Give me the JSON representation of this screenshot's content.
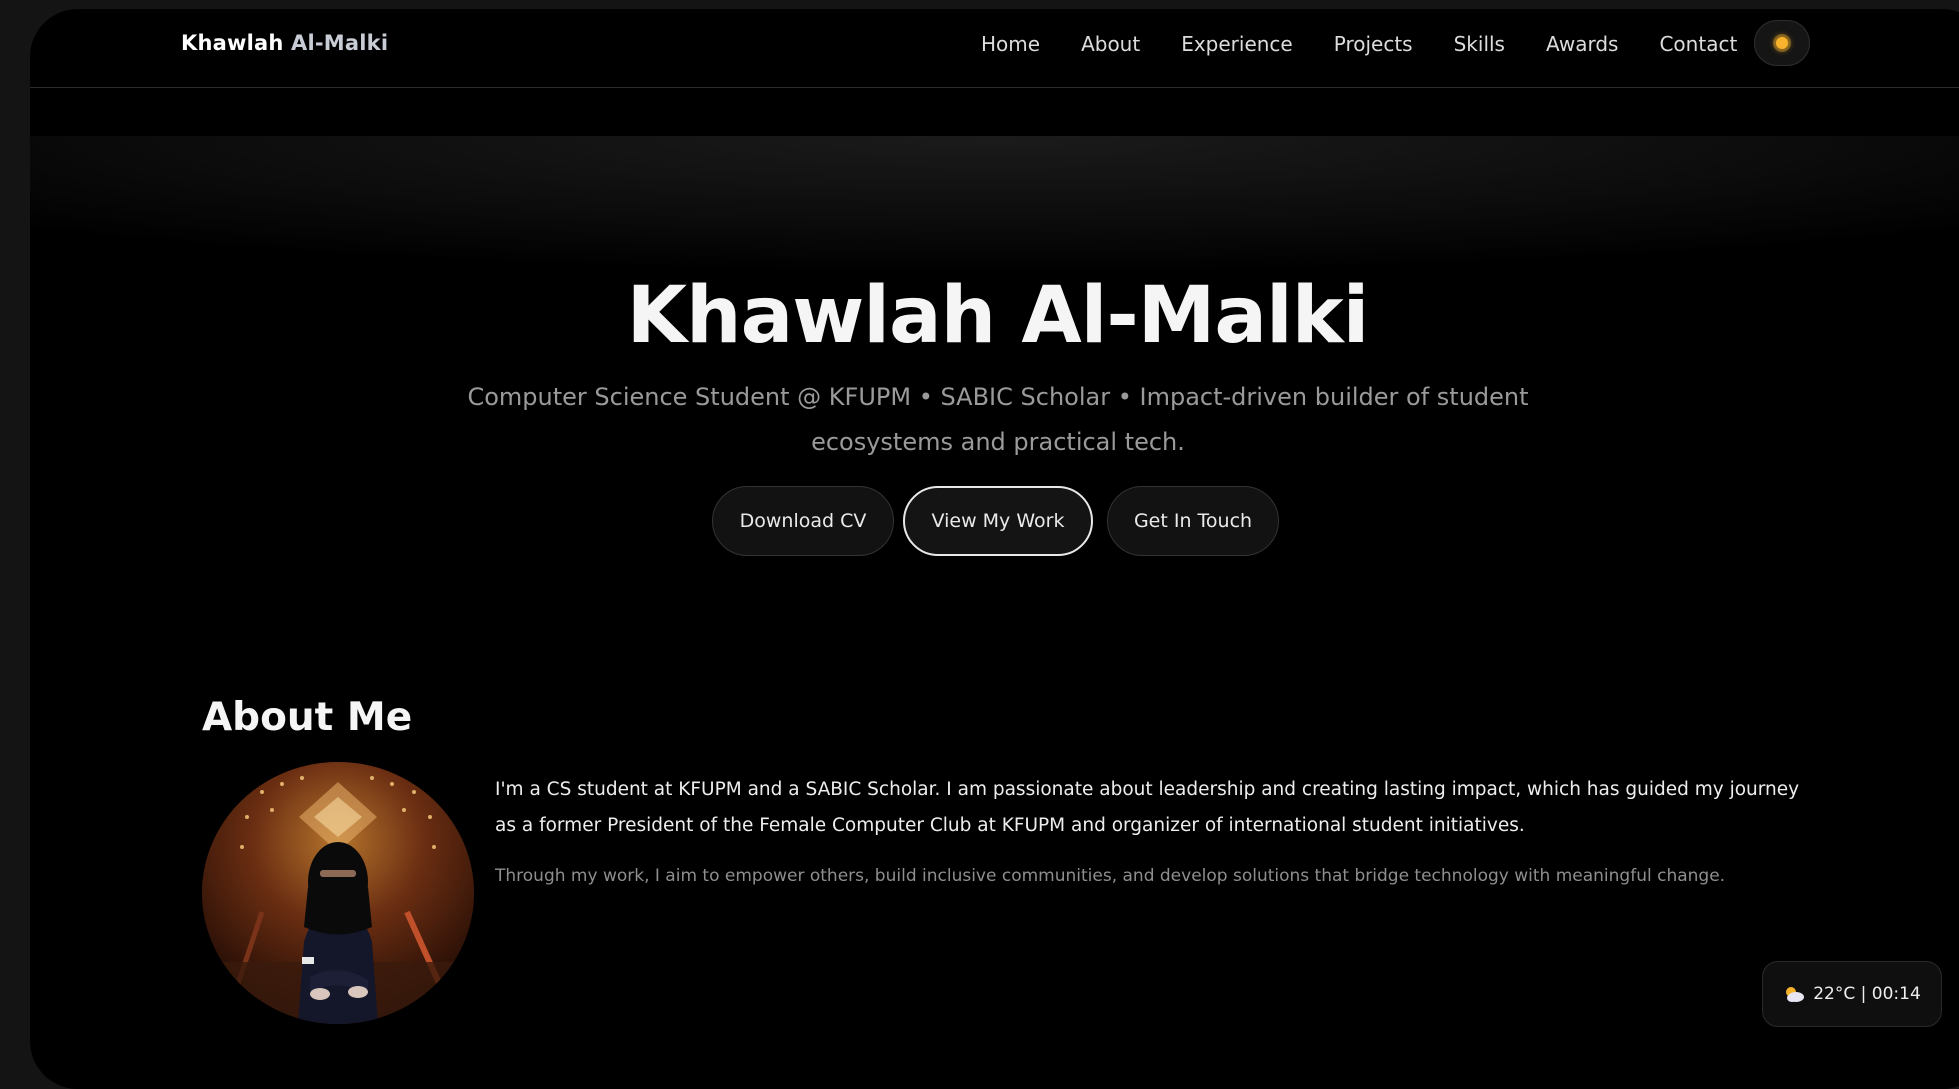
{
  "navbar": {
    "brand_first": "Khawlah",
    "brand_last": "Al-Malki",
    "links": [
      "Home",
      "About",
      "Experience",
      "Projects",
      "Skills",
      "Awards",
      "Contact"
    ],
    "theme_icon": "sun-icon"
  },
  "hero": {
    "title": "Khawlah Al-Malki",
    "subtitle": "Computer Science Student @ KFUPM • SABIC Scholar • Impact-driven builder of student ecosystems and practical tech.",
    "buttons": {
      "download_cv": "Download CV",
      "view_work": "View My Work",
      "get_in_touch": "Get In Touch"
    }
  },
  "about": {
    "title": "About Me",
    "paragraph1": "I'm a CS student at KFUPM and a SABIC Scholar. I am passionate about leadership and creating lasting impact, which has guided my journey as a former President of the Female Computer Club at KFUPM and organizer of international student initiatives.",
    "paragraph2": "Through my work, I aim to empower others, build inclusive communities, and develop solutions that bridge technology with meaningful change."
  },
  "weather": {
    "icon": "partly-cloudy-icon",
    "text": "22°C | 00:14"
  },
  "colors": {
    "page_background": "#000000",
    "outer_background": "#141414",
    "accent_sun": "#f7b32b",
    "muted_text": "#9a9a9a"
  }
}
